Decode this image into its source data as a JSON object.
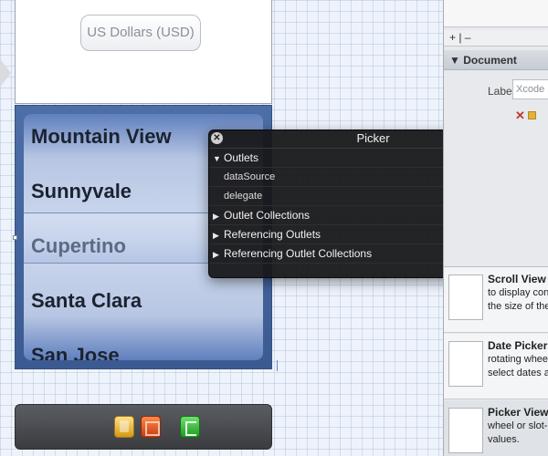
{
  "canvas": {
    "currency_button_label": "US Dollars (USD)",
    "picker_rows": [
      "Mountain View",
      "Sunnyvale",
      "Cupertino",
      "Santa Clara",
      "San Jose"
    ],
    "selected_row": "Cupertino"
  },
  "popover": {
    "title": "Picker",
    "close_glyph": "✕",
    "sections": [
      {
        "label": "Outlets",
        "expanded": true,
        "items": [
          "dataSource",
          "delegate"
        ]
      },
      {
        "label": "Outlet Collections",
        "expanded": false
      },
      {
        "label": "Referencing Outlets",
        "expanded": false
      },
      {
        "label": "Referencing Outlet Collections",
        "expanded": false
      }
    ]
  },
  "pane": {
    "add_remove": "+ | –",
    "section_title": "Document",
    "label_caption": "Label",
    "label_placeholder": "Xcode S",
    "library": [
      {
        "title": "Scroll View",
        "desc": "to display cont the size of the"
      },
      {
        "title": "Date Picker",
        "desc": "rotating wheels select dates an"
      },
      {
        "title": "Picker View",
        "desc": "wheel or slot-r values."
      }
    ]
  },
  "toolbar_icons": [
    "first-responder-cube-icon",
    "object-box-icon",
    "exit-icon"
  ]
}
